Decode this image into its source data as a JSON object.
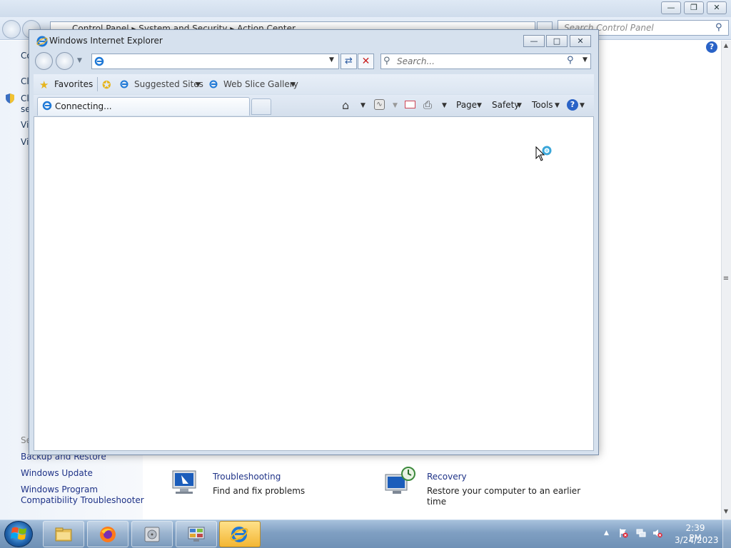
{
  "control_panel": {
    "breadcrumb": [
      "Control Panel",
      "System and Security",
      "Action Center"
    ],
    "search_placeholder": "Search Control Panel",
    "left_pane_truncated": [
      "Co",
      "Cl",
      "Cl",
      "se",
      "Vi",
      "Vi"
    ],
    "see_also": "Se",
    "links": [
      "Backup and Restore",
      "Windows Update",
      "Windows Program",
      "Compatibility Troubleshooter"
    ],
    "items": [
      {
        "title": "Troubleshooting",
        "desc": "Find and fix problems"
      },
      {
        "title": "Recovery",
        "desc_line1": "Restore your computer to an earlier",
        "desc_line2": "time"
      }
    ]
  },
  "ie": {
    "title": "Windows Internet Explorer",
    "search_placeholder": "Search...",
    "favorites": {
      "label": "Favorites",
      "items": [
        "Suggested Sites",
        "Web Slice Gallery"
      ]
    },
    "tab": {
      "label": "Connecting..."
    },
    "commands": [
      "Page",
      "Safety",
      "Tools"
    ]
  },
  "taskbar": {
    "time": "2:39 PM",
    "date": "3/24/2023",
    "apps": [
      "explorer",
      "firefox",
      "backup",
      "control-panel",
      "internet-explorer"
    ]
  },
  "colors": {
    "link": "#1e3287",
    "taskbar": "#7f9fc2",
    "ie_active_tab": "#f3b633"
  }
}
